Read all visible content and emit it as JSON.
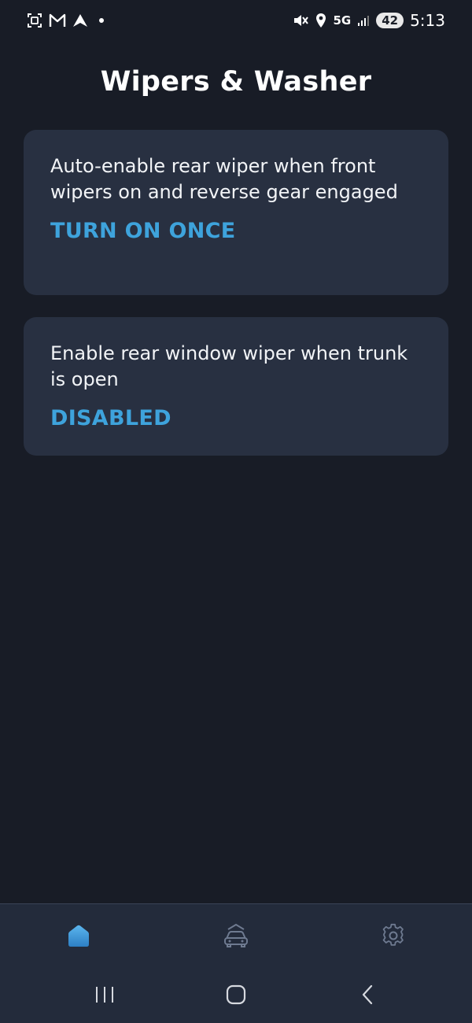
{
  "status_bar": {
    "left_icons": [
      "screenshot-icon",
      "gmail-icon",
      "app-arrow-icon",
      "notification-dot-icon"
    ],
    "right_icons": [
      "mute-vibrate-icon",
      "location-icon"
    ],
    "network": "5G",
    "battery": "42",
    "time": "5:13"
  },
  "page": {
    "title": "Wipers & Washer"
  },
  "settings": [
    {
      "description": "Auto-enable rear wiper when front wipers on and reverse gear engaged",
      "value": "TURN ON ONCE"
    },
    {
      "description": "Enable rear window wiper when trunk is open",
      "value": "DISABLED"
    }
  ],
  "bottom_nav": {
    "items": [
      {
        "icon": "home-icon",
        "active": true
      },
      {
        "icon": "car-icon",
        "active": false
      },
      {
        "icon": "gear-icon",
        "active": false
      }
    ]
  },
  "system_nav": {
    "buttons": [
      "recents-icon",
      "home-circle-icon",
      "back-icon"
    ]
  },
  "colors": {
    "background": "#181c26",
    "card": "#283041",
    "accent": "#3ea3dc",
    "nav_bar": "#232b3b"
  }
}
